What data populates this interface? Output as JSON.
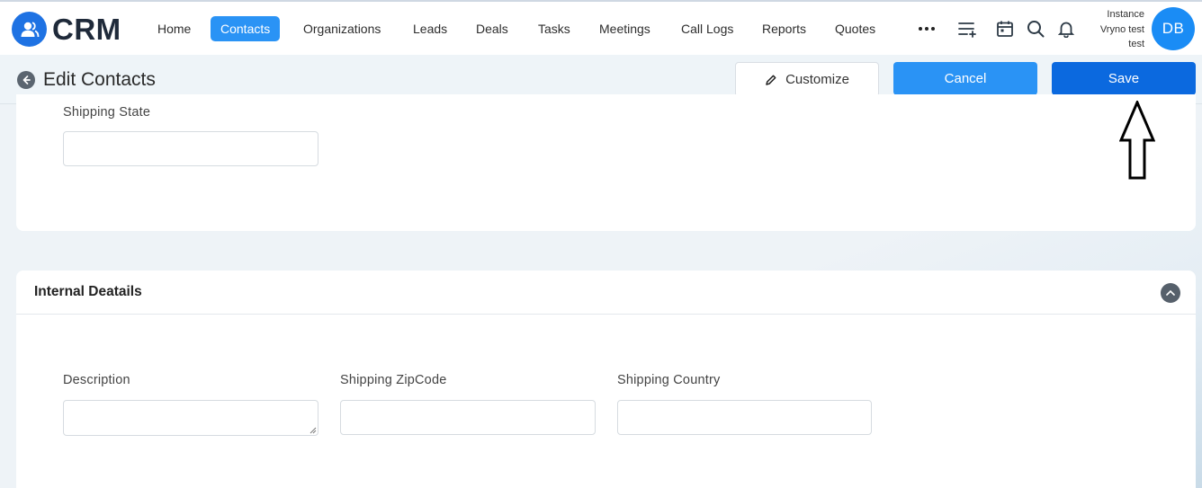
{
  "brand": {
    "name": "CRM",
    "color": "#1e72e3"
  },
  "nav": {
    "items": [
      {
        "label": "Home",
        "active": false
      },
      {
        "label": "Contacts",
        "active": true
      },
      {
        "label": "Organizations",
        "active": false
      },
      {
        "label": "Leads",
        "active": false
      },
      {
        "label": "Deals",
        "active": false
      },
      {
        "label": "Tasks",
        "active": false
      },
      {
        "label": "Meetings",
        "active": false
      },
      {
        "label": "Call Logs",
        "active": false
      },
      {
        "label": "Reports",
        "active": false
      },
      {
        "label": "Quotes",
        "active": false
      }
    ],
    "icons": [
      "more-dots-icon",
      "add-list-icon",
      "calendar-icon",
      "search-icon",
      "bell-icon"
    ]
  },
  "user": {
    "name_lines": [
      "Instance",
      "Vryno test",
      "test"
    ],
    "initials": "DB",
    "avatar_color": "#1a8cf5"
  },
  "header": {
    "title": "Edit Contacts",
    "customize_label": "Customize",
    "cancel_label": "Cancel",
    "save_label": "Save"
  },
  "section_top": {
    "fields": [
      {
        "label": "Shipping State",
        "value": ""
      }
    ]
  },
  "section_internal": {
    "title": "Internal Deatails",
    "fields": [
      {
        "label": "Description",
        "value": ""
      },
      {
        "label": "Shipping ZipCode",
        "value": ""
      },
      {
        "label": "Shipping Country",
        "value": ""
      }
    ]
  },
  "colors": {
    "primary": "#2a93f5",
    "save": "#0b69df",
    "page_bg": "#eef3f7"
  }
}
